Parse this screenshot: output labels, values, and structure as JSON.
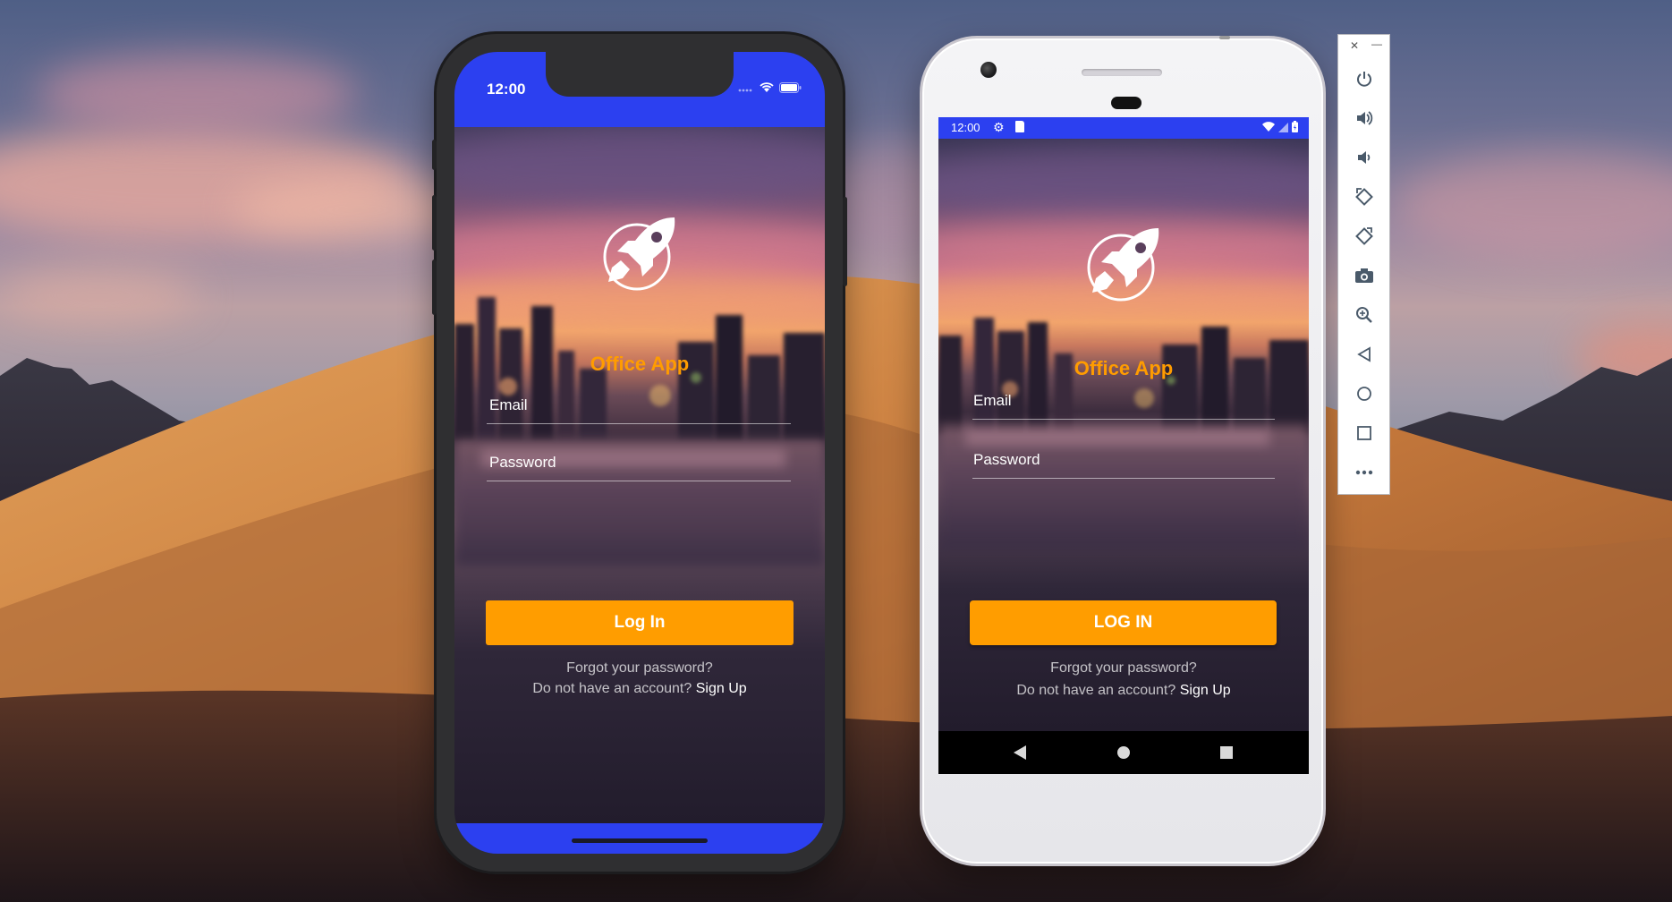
{
  "colors": {
    "status_bar": "#2c40f0",
    "accent": "#ff9c00",
    "button": "#ff9d00"
  },
  "iphone": {
    "status_time": "12:00",
    "app_title": "Office App",
    "email_label": "Email",
    "password_label": "Password",
    "login_label": "Log In",
    "forgot_text": "Forgot your password?",
    "signup_prefix": "Do not have an account?",
    "signup_link": "Sign Up"
  },
  "android": {
    "status_time": "12:00",
    "app_title": "Office App",
    "email_label": "Email",
    "password_label": "Password",
    "login_label": "LOG IN",
    "forgot_text": "Forgot your password?",
    "signup_prefix": "Do not have an account?",
    "signup_link": "Sign Up",
    "nav": [
      "back-icon",
      "home-icon",
      "recents-icon"
    ]
  },
  "emulator_toolbar": {
    "window_controls": [
      "close-icon",
      "minimize-icon"
    ],
    "items": [
      "power-icon",
      "volume-up-icon",
      "volume-down-icon",
      "rotate-left-icon",
      "rotate-right-icon",
      "camera-icon",
      "zoom-icon",
      "back-icon",
      "home-icon",
      "overview-icon",
      "more-icon"
    ]
  }
}
